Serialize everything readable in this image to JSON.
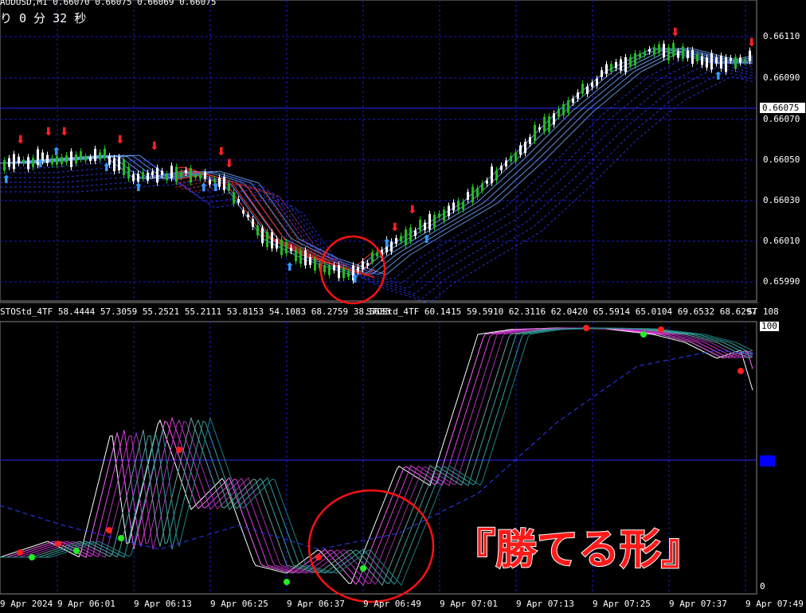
{
  "header": {
    "symbol_line": "AUDUSD,M1  0.66070 0.66075 0.66069 0.66075",
    "countdown": "り 0 分 32 秒"
  },
  "price_axis": {
    "ticks": [
      "0.66110",
      "0.66090",
      "0.66070",
      "0.66050",
      "0.66030",
      "0.66010",
      "0.65990"
    ],
    "current_price": "0.66075"
  },
  "indicator_labels": {
    "label_1": "STOStd_4TF 58.4444 57.3059 55.2521 55.2111 53.8153 54.1083 68.2759 38.5635",
    "label_2": "STOStd_4TF 60.1415 59.5910 62.3116 62.0420 65.5914 65.0104 69.6532 68.6297",
    "label_3": "ST 108"
  },
  "oscillator_axis": {
    "max": "100",
    "mid": "50",
    "min": "0"
  },
  "time_axis": [
    "9 Apr 2024",
    "9 Apr 06:01",
    "9 Apr 06:13",
    "9 Apr 06:25",
    "9 Apr 06:37",
    "9 Apr 06:49",
    "9 Apr 07:01",
    "9 Apr 07:13",
    "9 Apr 07:25",
    "9 Apr 07:37",
    "9 Apr 07:49"
  ],
  "caption": "『勝てる形』",
  "colors": {
    "background": "#000000",
    "grid": "#1a1acc",
    "bull_candle": "#22bb22",
    "bear_candle": "#ffffff",
    "sell_arrow": "#ff2020",
    "buy_arrow": "#3399ff",
    "highlight_circle": "#ff1111",
    "caption": "#ff1a1a"
  },
  "icons": [
    "sell-arrow-icon",
    "buy-arrow-icon"
  ]
}
